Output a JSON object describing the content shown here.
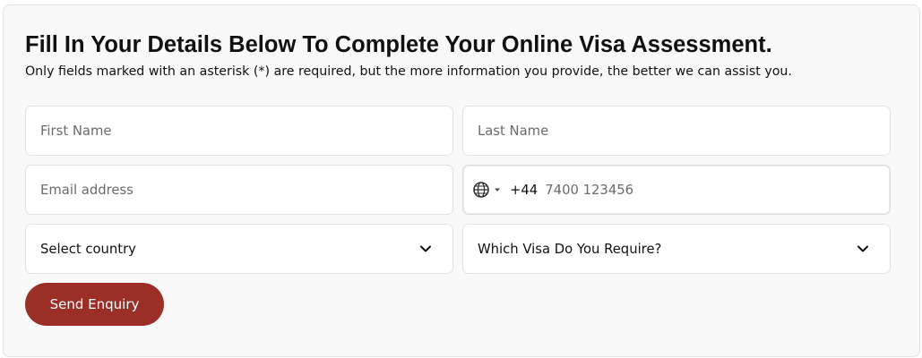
{
  "form": {
    "title": "Fill In Your Details Below To Complete Your Online Visa Assessment.",
    "subtitle": "Only fields marked with an asterisk (*) are required, but the more information you provide, the better we can assist you.",
    "first_name": {
      "value": "",
      "placeholder": "First Name"
    },
    "last_name": {
      "value": "",
      "placeholder": "Last Name"
    },
    "email": {
      "value": "",
      "placeholder": "Email address"
    },
    "phone": {
      "dial_code": "+44",
      "value": "",
      "placeholder": "7400 123456",
      "flag_icon": "globe-icon"
    },
    "country_select": {
      "selected": "Select country",
      "icon": "chevron-down-icon"
    },
    "visa_select": {
      "selected": "Which Visa Do You Require?",
      "icon": "chevron-down-icon"
    },
    "submit_label": "Send Enquiry"
  },
  "colors": {
    "card_background": "#f9f9f9",
    "button_background": "#9b2f28",
    "button_text": "#ffffff",
    "placeholder": "#6b6b6b"
  }
}
